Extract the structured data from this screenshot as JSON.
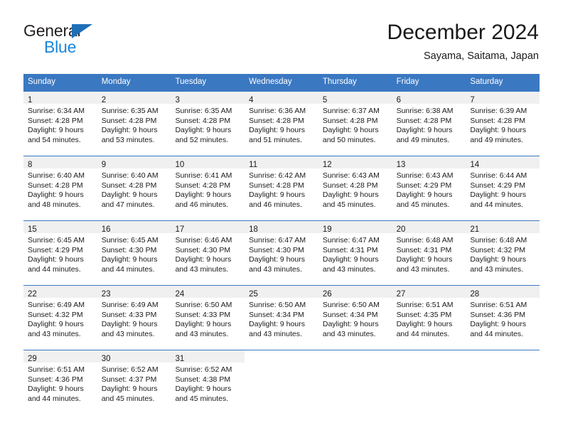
{
  "brand": {
    "name_top": "General",
    "name_bottom": "Blue",
    "triangle_color": "#1e6fb8",
    "blue_text_color": "#1b85d6"
  },
  "header": {
    "title": "December 2024",
    "subtitle": "Sayama, Saitama, Japan"
  },
  "theme": {
    "header_bar_color": "#3b78c2",
    "daynum_band_color": "#f0f0f0",
    "text_color": "#1a1a1a",
    "page_background": "#ffffff"
  },
  "weekdays": [
    "Sunday",
    "Monday",
    "Tuesday",
    "Wednesday",
    "Thursday",
    "Friday",
    "Saturday"
  ],
  "weeks": [
    [
      {
        "day": "1",
        "sunrise": "Sunrise: 6:34 AM",
        "sunset": "Sunset: 4:28 PM",
        "daylight1": "Daylight: 9 hours",
        "daylight2": "and 54 minutes."
      },
      {
        "day": "2",
        "sunrise": "Sunrise: 6:35 AM",
        "sunset": "Sunset: 4:28 PM",
        "daylight1": "Daylight: 9 hours",
        "daylight2": "and 53 minutes."
      },
      {
        "day": "3",
        "sunrise": "Sunrise: 6:35 AM",
        "sunset": "Sunset: 4:28 PM",
        "daylight1": "Daylight: 9 hours",
        "daylight2": "and 52 minutes."
      },
      {
        "day": "4",
        "sunrise": "Sunrise: 6:36 AM",
        "sunset": "Sunset: 4:28 PM",
        "daylight1": "Daylight: 9 hours",
        "daylight2": "and 51 minutes."
      },
      {
        "day": "5",
        "sunrise": "Sunrise: 6:37 AM",
        "sunset": "Sunset: 4:28 PM",
        "daylight1": "Daylight: 9 hours",
        "daylight2": "and 50 minutes."
      },
      {
        "day": "6",
        "sunrise": "Sunrise: 6:38 AM",
        "sunset": "Sunset: 4:28 PM",
        "daylight1": "Daylight: 9 hours",
        "daylight2": "and 49 minutes."
      },
      {
        "day": "7",
        "sunrise": "Sunrise: 6:39 AM",
        "sunset": "Sunset: 4:28 PM",
        "daylight1": "Daylight: 9 hours",
        "daylight2": "and 49 minutes."
      }
    ],
    [
      {
        "day": "8",
        "sunrise": "Sunrise: 6:40 AM",
        "sunset": "Sunset: 4:28 PM",
        "daylight1": "Daylight: 9 hours",
        "daylight2": "and 48 minutes."
      },
      {
        "day": "9",
        "sunrise": "Sunrise: 6:40 AM",
        "sunset": "Sunset: 4:28 PM",
        "daylight1": "Daylight: 9 hours",
        "daylight2": "and 47 minutes."
      },
      {
        "day": "10",
        "sunrise": "Sunrise: 6:41 AM",
        "sunset": "Sunset: 4:28 PM",
        "daylight1": "Daylight: 9 hours",
        "daylight2": "and 46 minutes."
      },
      {
        "day": "11",
        "sunrise": "Sunrise: 6:42 AM",
        "sunset": "Sunset: 4:28 PM",
        "daylight1": "Daylight: 9 hours",
        "daylight2": "and 46 minutes."
      },
      {
        "day": "12",
        "sunrise": "Sunrise: 6:43 AM",
        "sunset": "Sunset: 4:28 PM",
        "daylight1": "Daylight: 9 hours",
        "daylight2": "and 45 minutes."
      },
      {
        "day": "13",
        "sunrise": "Sunrise: 6:43 AM",
        "sunset": "Sunset: 4:29 PM",
        "daylight1": "Daylight: 9 hours",
        "daylight2": "and 45 minutes."
      },
      {
        "day": "14",
        "sunrise": "Sunrise: 6:44 AM",
        "sunset": "Sunset: 4:29 PM",
        "daylight1": "Daylight: 9 hours",
        "daylight2": "and 44 minutes."
      }
    ],
    [
      {
        "day": "15",
        "sunrise": "Sunrise: 6:45 AM",
        "sunset": "Sunset: 4:29 PM",
        "daylight1": "Daylight: 9 hours",
        "daylight2": "and 44 minutes."
      },
      {
        "day": "16",
        "sunrise": "Sunrise: 6:45 AM",
        "sunset": "Sunset: 4:30 PM",
        "daylight1": "Daylight: 9 hours",
        "daylight2": "and 44 minutes."
      },
      {
        "day": "17",
        "sunrise": "Sunrise: 6:46 AM",
        "sunset": "Sunset: 4:30 PM",
        "daylight1": "Daylight: 9 hours",
        "daylight2": "and 43 minutes."
      },
      {
        "day": "18",
        "sunrise": "Sunrise: 6:47 AM",
        "sunset": "Sunset: 4:30 PM",
        "daylight1": "Daylight: 9 hours",
        "daylight2": "and 43 minutes."
      },
      {
        "day": "19",
        "sunrise": "Sunrise: 6:47 AM",
        "sunset": "Sunset: 4:31 PM",
        "daylight1": "Daylight: 9 hours",
        "daylight2": "and 43 minutes."
      },
      {
        "day": "20",
        "sunrise": "Sunrise: 6:48 AM",
        "sunset": "Sunset: 4:31 PM",
        "daylight1": "Daylight: 9 hours",
        "daylight2": "and 43 minutes."
      },
      {
        "day": "21",
        "sunrise": "Sunrise: 6:48 AM",
        "sunset": "Sunset: 4:32 PM",
        "daylight1": "Daylight: 9 hours",
        "daylight2": "and 43 minutes."
      }
    ],
    [
      {
        "day": "22",
        "sunrise": "Sunrise: 6:49 AM",
        "sunset": "Sunset: 4:32 PM",
        "daylight1": "Daylight: 9 hours",
        "daylight2": "and 43 minutes."
      },
      {
        "day": "23",
        "sunrise": "Sunrise: 6:49 AM",
        "sunset": "Sunset: 4:33 PM",
        "daylight1": "Daylight: 9 hours",
        "daylight2": "and 43 minutes."
      },
      {
        "day": "24",
        "sunrise": "Sunrise: 6:50 AM",
        "sunset": "Sunset: 4:33 PM",
        "daylight1": "Daylight: 9 hours",
        "daylight2": "and 43 minutes."
      },
      {
        "day": "25",
        "sunrise": "Sunrise: 6:50 AM",
        "sunset": "Sunset: 4:34 PM",
        "daylight1": "Daylight: 9 hours",
        "daylight2": "and 43 minutes."
      },
      {
        "day": "26",
        "sunrise": "Sunrise: 6:50 AM",
        "sunset": "Sunset: 4:34 PM",
        "daylight1": "Daylight: 9 hours",
        "daylight2": "and 43 minutes."
      },
      {
        "day": "27",
        "sunrise": "Sunrise: 6:51 AM",
        "sunset": "Sunset: 4:35 PM",
        "daylight1": "Daylight: 9 hours",
        "daylight2": "and 44 minutes."
      },
      {
        "day": "28",
        "sunrise": "Sunrise: 6:51 AM",
        "sunset": "Sunset: 4:36 PM",
        "daylight1": "Daylight: 9 hours",
        "daylight2": "and 44 minutes."
      }
    ],
    [
      {
        "day": "29",
        "sunrise": "Sunrise: 6:51 AM",
        "sunset": "Sunset: 4:36 PM",
        "daylight1": "Daylight: 9 hours",
        "daylight2": "and 44 minutes."
      },
      {
        "day": "30",
        "sunrise": "Sunrise: 6:52 AM",
        "sunset": "Sunset: 4:37 PM",
        "daylight1": "Daylight: 9 hours",
        "daylight2": "and 45 minutes."
      },
      {
        "day": "31",
        "sunrise": "Sunrise: 6:52 AM",
        "sunset": "Sunset: 4:38 PM",
        "daylight1": "Daylight: 9 hours",
        "daylight2": "and 45 minutes."
      },
      {
        "day": "",
        "sunrise": "",
        "sunset": "",
        "daylight1": "",
        "daylight2": ""
      },
      {
        "day": "",
        "sunrise": "",
        "sunset": "",
        "daylight1": "",
        "daylight2": ""
      },
      {
        "day": "",
        "sunrise": "",
        "sunset": "",
        "daylight1": "",
        "daylight2": ""
      },
      {
        "day": "",
        "sunrise": "",
        "sunset": "",
        "daylight1": "",
        "daylight2": ""
      }
    ]
  ]
}
